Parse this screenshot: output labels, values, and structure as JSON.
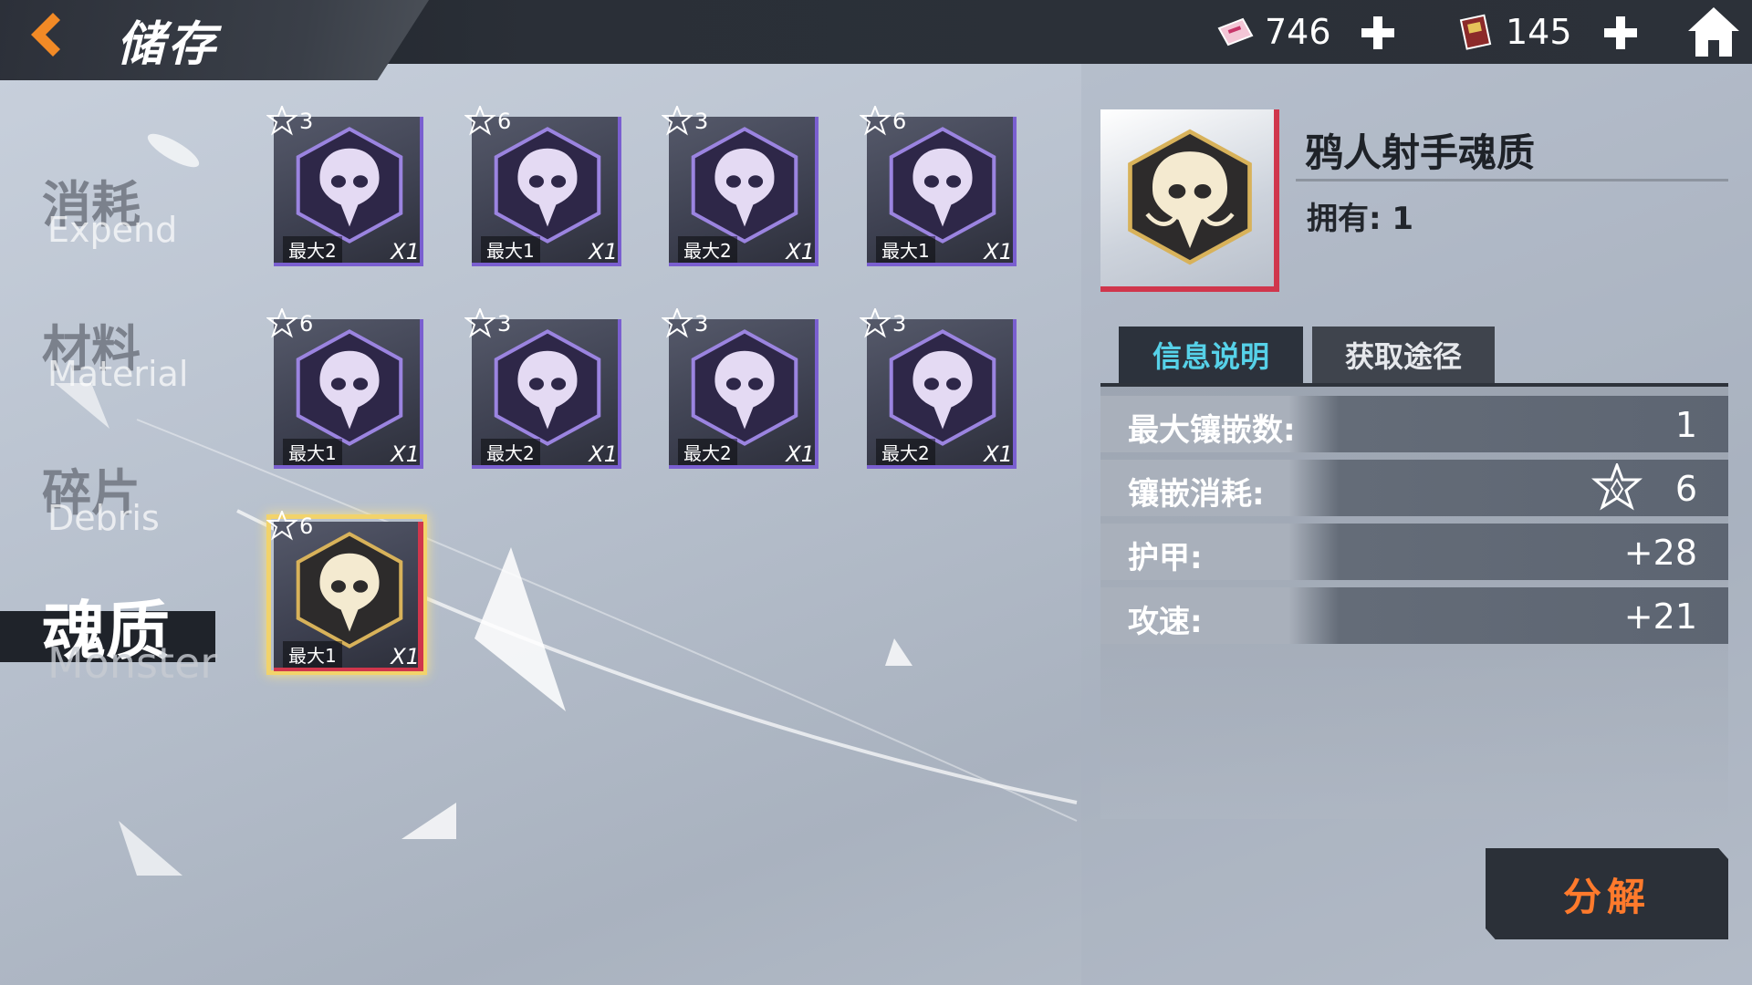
{
  "header": {
    "title": "储存",
    "currency_1": {
      "value": "746",
      "icon": "ticket-icon"
    },
    "currency_2": {
      "value": "145",
      "icon": "card-pack-icon"
    }
  },
  "sidebar": {
    "tabs": [
      {
        "cn": "消耗",
        "en": "Expend",
        "active": false
      },
      {
        "cn": "材料",
        "en": "Material",
        "active": false
      },
      {
        "cn": "碎片",
        "en": "Debris",
        "active": false
      },
      {
        "cn": "魂质",
        "en": "Monster",
        "active": true
      }
    ]
  },
  "grid": {
    "items": [
      {
        "rarity": "3",
        "max": "最大2",
        "qty": "X1"
      },
      {
        "rarity": "6",
        "max": "最大1",
        "qty": "X1"
      },
      {
        "rarity": "3",
        "max": "最大2",
        "qty": "X1"
      },
      {
        "rarity": "6",
        "max": "最大1",
        "qty": "X1"
      },
      {
        "rarity": "6",
        "max": "最大1",
        "qty": "X1"
      },
      {
        "rarity": "3",
        "max": "最大2",
        "qty": "X1"
      },
      {
        "rarity": "3",
        "max": "最大2",
        "qty": "X1"
      },
      {
        "rarity": "3",
        "max": "最大2",
        "qty": "X1"
      },
      {
        "rarity": "6",
        "max": "最大1",
        "qty": "X1",
        "selected": true
      }
    ]
  },
  "detail": {
    "name": "鸦人射手魂质",
    "owned": "拥有: 1",
    "tabs": {
      "info": "信息说明",
      "source": "获取途径"
    },
    "stats": [
      {
        "label": "最大镶嵌数:",
        "value": "1"
      },
      {
        "label": "镶嵌消耗:",
        "value": "6"
      },
      {
        "label": "护甲:",
        "value": "+28"
      },
      {
        "label": "攻速:",
        "value": "+21"
      }
    ],
    "decompose_label": "分解"
  },
  "colors": {
    "accent_orange": "#ff7a2c",
    "tab_active_text": "#56d1e8",
    "rarity_purple": "#7a5fd0",
    "selected_red": "#d0364c",
    "selected_gold": "#f2d36b"
  }
}
